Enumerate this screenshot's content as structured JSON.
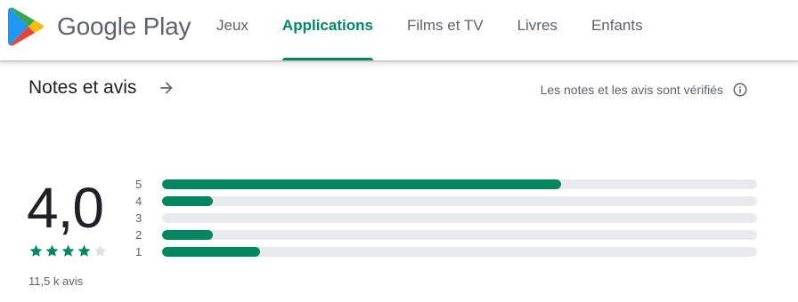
{
  "brand": {
    "name": "Google Play",
    "icon": "google-play-logo-icon"
  },
  "nav": {
    "tabs": [
      {
        "label": "Jeux",
        "active": false
      },
      {
        "label": "Applications",
        "active": true
      },
      {
        "label": "Films et TV",
        "active": false
      },
      {
        "label": "Livres",
        "active": false
      },
      {
        "label": "Enfants",
        "active": false
      }
    ]
  },
  "ratings": {
    "title": "Notes et avis",
    "title_icon": "arrow-right-icon",
    "verified_text": "Les notes et les avis sont vérifiés",
    "verified_icon": "info-icon",
    "average": "4,0",
    "stars_value": 4,
    "stars_total": 5,
    "review_count": "11,5 k avis",
    "histogram": [
      {
        "label": "5",
        "fraction": 0.67
      },
      {
        "label": "4",
        "fraction": 0.085
      },
      {
        "label": "3",
        "fraction": 0.0
      },
      {
        "label": "2",
        "fraction": 0.085
      },
      {
        "label": "1",
        "fraction": 0.165
      }
    ]
  },
  "colors": {
    "accent": "#01875f",
    "track": "#e8eaed",
    "text_primary": "#202124",
    "text_secondary": "#5f6368",
    "star_empty": "#e0e0e0"
  }
}
